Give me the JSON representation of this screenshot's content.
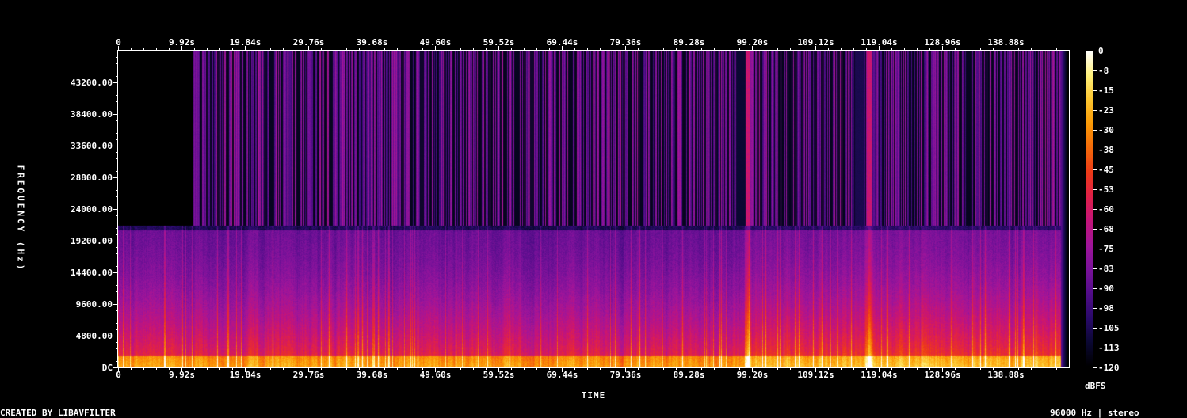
{
  "chart_data": {
    "type": "heatmap",
    "kind": "spectrogram",
    "x_tick_labels": [
      "0",
      "9.92s",
      "19.84s",
      "29.76s",
      "39.68s",
      "49.60s",
      "59.52s",
      "69.44s",
      "79.36s",
      "89.28s",
      "99.20s",
      "109.12s",
      "119.04s",
      "128.96s",
      "138.88s"
    ],
    "x_tick_seconds": [
      0,
      9.92,
      19.84,
      29.76,
      39.68,
      49.6,
      59.52,
      69.44,
      79.36,
      89.28,
      99.2,
      109.12,
      119.04,
      128.96,
      138.88
    ],
    "x_range_seconds": [
      0,
      148.8
    ],
    "y_tick_labels": [
      "DC",
      "4800.00",
      "9600.00",
      "14400.00",
      "19200.00",
      "24000.00",
      "28800.00",
      "33600.00",
      "38400.00",
      "43200.00"
    ],
    "y_tick_hz": [
      0,
      4800,
      9600,
      14400,
      19200,
      24000,
      28800,
      33600,
      38400,
      43200
    ],
    "y_range_hz": [
      0,
      48000
    ],
    "xlabel": "TIME",
    "ylabel": "FREQUENCY (Hz)",
    "colorbar": {
      "unit": "dBFS",
      "tick_labels": [
        "0",
        "-8",
        "-15",
        "-23",
        "-30",
        "-38",
        "-45",
        "-53",
        "-60",
        "-68",
        "-75",
        "-83",
        "-90",
        "-98",
        "-105",
        "-113",
        "-120"
      ],
      "range_dbfs": [
        -120,
        0
      ],
      "colors": [
        "#000000",
        "#0b0833",
        "#2a0a6b",
        "#520d8a",
        "#7a129a",
        "#a0159a",
        "#c4147a",
        "#e0204a",
        "#ee3a18",
        "#f56a0a",
        "#fb9a06",
        "#fdc630",
        "#fff17a",
        "#ffffff"
      ]
    },
    "content_cutoff_hz": 21500,
    "signal_end_seconds": 147.5,
    "bright_events_seconds": [
      98.5,
      117.5
    ]
  },
  "footer": {
    "left": "CREATED BY LIBAVFILTER",
    "right": "96000 Hz | stereo"
  }
}
